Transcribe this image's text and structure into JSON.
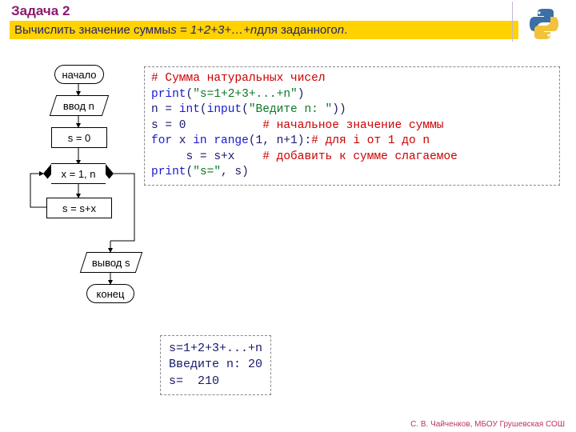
{
  "title": "Задача 2",
  "task_prefix": "Вычислить значение суммы ",
  "task_formula": "s = 1+2+3+…+n",
  "task_suffix": "  для заданного ",
  "task_n": "n",
  "task_tail": ".",
  "flow": {
    "start": "начало",
    "input": "ввод n",
    "init": "s = 0",
    "loop": "x = 1, n",
    "body": "s = s+x",
    "output": "вывод s",
    "end": "конец"
  },
  "code": {
    "l1": "# Сумма натуральных чисел",
    "l2a": "print",
    "l2b": "(",
    "l2c": "\"s=1+2+3+...+n\"",
    "l2d": ")",
    "l3a": "n = ",
    "l3b": "int",
    "l3c": "(",
    "l3d": "input",
    "l3e": "(",
    "l3f": "\"Ведите n: \"",
    "l3g": "))",
    "l4a": "s = 0           ",
    "l4b": "# начальное значение суммы",
    "l5a": "for",
    "l5b": " x ",
    "l5c": "in",
    "l5d": " ",
    "l5e": "range",
    "l5f": "(1, n+1):",
    "l5g": "# для i от 1 до n",
    "l6a": "     s = s+x    ",
    "l6b": "# добавить к сумме слагаемое",
    "l7a": "print",
    "l7b": "(",
    "l7c": "\"s=\"",
    "l7d": ", s)"
  },
  "output": {
    "l1": "s=1+2+3+...+n",
    "l2a": "Введите n: ",
    "l2b": "20",
    "l3": "s=  210"
  },
  "footer": "С. В. Чайченков, МБОУ Грушевская СОШ"
}
